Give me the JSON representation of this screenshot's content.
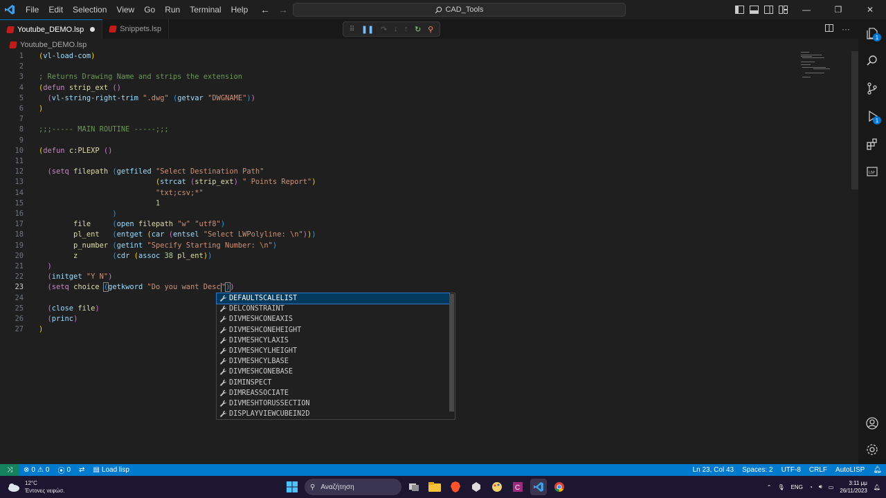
{
  "titlebar": {
    "menu": [
      "File",
      "Edit",
      "Selection",
      "View",
      "Go",
      "Run",
      "Terminal",
      "Help"
    ],
    "search_text": "CAD_Tools"
  },
  "tabs": [
    {
      "label": "Youtube_DEMO.lsp",
      "active": true,
      "dirty": true
    },
    {
      "label": "Snippets.lsp",
      "active": false,
      "dirty": false
    }
  ],
  "breadcrumb": {
    "file": "Youtube_DEMO.lsp"
  },
  "editor": {
    "lines": [
      {
        "n": "1",
        "html": "<span class='tok-par'>(</span><span class='tok-fn'>vl-load-com</span><span class='tok-par'>)</span>"
      },
      {
        "n": "2",
        "html": ""
      },
      {
        "n": "3",
        "html": "<span class='tok-com'>; Returns Drawing Name and strips the extension</span>"
      },
      {
        "n": "4",
        "html": "<span class='tok-par'>(</span><span class='tok-kw'>defun</span> <span class='tok-var'>strip_ext</span> <span class='tok-par2'>()</span>"
      },
      {
        "n": "5",
        "html": "  <span class='tok-par2'>(</span><span class='tok-fn'>vl-string-right-trim</span> <span class='tok-str'>\".dwg\"</span> <span class='tok-par3'>(</span><span class='tok-fn'>getvar</span> <span class='tok-str'>\"DWGNAME\"</span><span class='tok-par3'>)</span><span class='tok-par2'>)</span>"
      },
      {
        "n": "6",
        "html": "<span class='tok-par'>)</span>"
      },
      {
        "n": "7",
        "html": ""
      },
      {
        "n": "8",
        "html": "<span class='tok-com'>;;;----- MAIN ROUTINE -----;;;</span>"
      },
      {
        "n": "9",
        "html": ""
      },
      {
        "n": "10",
        "html": "<span class='tok-par'>(</span><span class='tok-kw'>defun</span> <span class='tok-var'>c:PLEXP</span> <span class='tok-par2'>()</span>"
      },
      {
        "n": "11",
        "html": ""
      },
      {
        "n": "12",
        "html": "  <span class='tok-par2'>(</span><span class='tok-kw'>setq</span> <span class='tok-var'>filepath</span> <span class='tok-par3'>(</span><span class='tok-fn'>getfiled</span> <span class='tok-str'>\"Select Destination Path\"</span>"
      },
      {
        "n": "13",
        "html": "                           <span class='tok-par'>(</span><span class='tok-fn'>strcat</span> <span class='tok-par2'>(</span><span class='tok-var'>strip_ext</span><span class='tok-par2'>)</span> <span class='tok-str'>\" Points Report\"</span><span class='tok-par'>)</span>"
      },
      {
        "n": "14",
        "html": "                           <span class='tok-str'>\"txt;csv;*\"</span>"
      },
      {
        "n": "15",
        "html": "                           <span class='tok-num'>1</span>"
      },
      {
        "n": "16",
        "html": "                 <span class='tok-par3'>)</span>"
      },
      {
        "n": "17",
        "html": "        <span class='tok-var'>file</span>     <span class='tok-par3'>(</span><span class='tok-fn'>open</span> <span class='tok-var'>filepath</span> <span class='tok-str'>\"w\"</span> <span class='tok-str'>\"utf8\"</span><span class='tok-par3'>)</span>"
      },
      {
        "n": "18",
        "html": "        <span class='tok-var'>pl_ent</span>   <span class='tok-par3'>(</span><span class='tok-fn'>entget</span> <span class='tok-par'>(</span><span class='tok-fn'>car</span> <span class='tok-par2'>(</span><span class='tok-fn'>entsel</span> <span class='tok-str'>\"Select LWPolyline: \\n\"</span><span class='tok-par2'>)</span><span class='tok-par'>)</span><span class='tok-par3'>)</span>"
      },
      {
        "n": "19",
        "html": "        <span class='tok-var'>p_number</span> <span class='tok-par3'>(</span><span class='tok-fn'>getint</span> <span class='tok-str'>\"Specify Starting Number: \\n\"</span><span class='tok-par3'>)</span>"
      },
      {
        "n": "20",
        "html": "        <span class='tok-var'>z</span>        <span class='tok-par3'>(</span><span class='tok-fn'>cdr</span> <span class='tok-par'>(</span><span class='tok-fn'>assoc</span> <span class='tok-num'>38</span> <span class='tok-var'>pl_ent</span><span class='tok-par'>)</span><span class='tok-par3'>)</span>"
      },
      {
        "n": "21",
        "html": "  <span class='tok-par2'>)</span>"
      },
      {
        "n": "22",
        "html": "  <span class='tok-par2'>(</span><span class='tok-fn'>initget</span> <span class='tok-str'>\"Y N\"</span><span class='tok-par2'>)</span>"
      },
      {
        "n": "23",
        "html": "  <span class='tok-par2'>(</span><span class='tok-kw'>setq</span> <span class='tok-var'>choice</span> <span class='tok-par3 bracket-box'>(</span><span class='tok-fn'>getkword</span> <span class='tok-str'>\"Do you want Desc</span><span class='cursor'></span><span class='tok-str'>\"</span><span class='tok-par3 bracket-box'>)</span><span class='tok-par2'>)</span>",
        "current": true
      },
      {
        "n": "24",
        "html": ""
      },
      {
        "n": "25",
        "html": "  <span class='tok-par2'>(</span><span class='tok-fn'>close</span> <span class='tok-var'>file</span><span class='tok-par2'>)</span>"
      },
      {
        "n": "26",
        "html": "  <span class='tok-par2'>(</span><span class='tok-fn'>princ</span><span class='tok-par2'>)</span>"
      },
      {
        "n": "27",
        "html": "<span class='tok-par'>)</span>"
      }
    ]
  },
  "suggestions": [
    {
      "label": "DEFAULTSCALELIST",
      "selected": true
    },
    {
      "label": "DELCONSTRAINT",
      "selected": false
    },
    {
      "label": "DIVMESHCONEAXIS",
      "selected": false
    },
    {
      "label": "DIVMESHCONEHEIGHT",
      "selected": false
    },
    {
      "label": "DIVMESHCYLAXIS",
      "selected": false
    },
    {
      "label": "DIVMESHCYLHEIGHT",
      "selected": false
    },
    {
      "label": "DIVMESHCYLBASE",
      "selected": false
    },
    {
      "label": "DIVMESHCONEBASE",
      "selected": false
    },
    {
      "label": "DIMINSPECT",
      "selected": false
    },
    {
      "label": "DIMREASSOCIATE",
      "selected": false
    },
    {
      "label": "DIVMESHTORUSSECTION",
      "selected": false
    },
    {
      "label": "DISPLAYVIEWCUBEIN2D",
      "selected": false
    }
  ],
  "statusbar": {
    "errors": "0",
    "warnings": "0",
    "ports": "0",
    "load_label": "Load lisp",
    "position": "Ln 23, Col 43",
    "spaces": "Spaces: 2",
    "encoding": "UTF-8",
    "eol": "CRLF",
    "language": "AutoLISP"
  },
  "taskbar": {
    "weather_temp": "12°C",
    "weather_desc": "Έντονες νεφώσ.",
    "search_placeholder": "Αναζήτηση",
    "lang": "ENG",
    "time": "3:11 μμ",
    "date": "26/11/2023"
  },
  "colors": {
    "accent": "#007acc",
    "editor_bg": "#1f1f1f"
  }
}
